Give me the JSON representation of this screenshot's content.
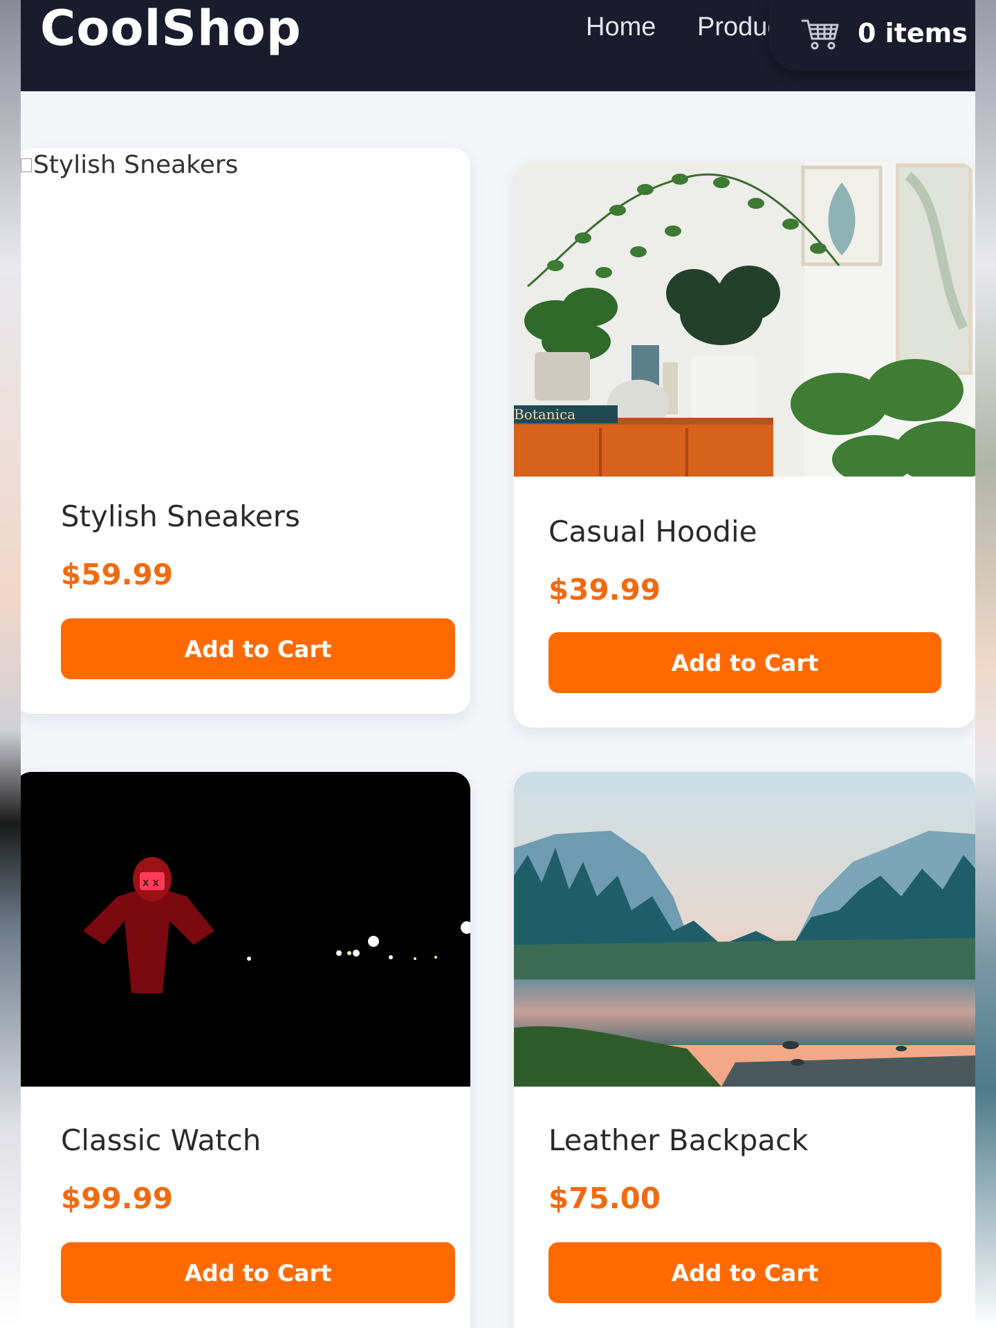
{
  "header": {
    "logo": "CoolShop",
    "nav": [
      {
        "label": "Home"
      },
      {
        "label": "Products"
      }
    ],
    "cart": {
      "count_label": "0 items",
      "icon": "shopping-cart-icon"
    }
  },
  "products": [
    {
      "name": "Stylish Sneakers",
      "price": "$59.99",
      "button": "Add to Cart",
      "image_alt": "Stylish Sneakers",
      "image": "broken-image"
    },
    {
      "name": "Casual Hoodie",
      "price": "$39.99",
      "button": "Add to Cart",
      "image_text": "Botanica",
      "image": "plants-on-shelf-photo"
    },
    {
      "name": "Classic Watch",
      "price": "$99.99",
      "button": "Add to Cart",
      "image": "red-hooded-figure-at-night-photo"
    },
    {
      "name": "Leather Backpack",
      "price": "$75.00",
      "button": "Add to Cart",
      "image": "mountain-river-landscape-photo"
    }
  ],
  "colors": {
    "header_bg": "#1b1b2e",
    "accent": "#ff6a00",
    "price": "#f26a10",
    "page_bg": "#f4f5f9"
  }
}
